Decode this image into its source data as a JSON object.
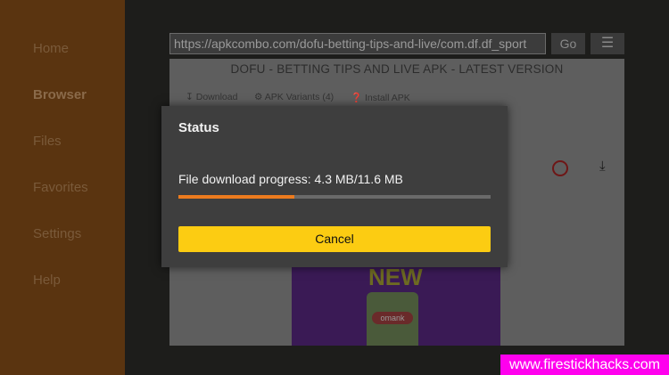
{
  "sidebar": {
    "items": [
      {
        "label": "Home"
      },
      {
        "label": "Browser"
      },
      {
        "label": "Files"
      },
      {
        "label": "Favorites"
      },
      {
        "label": "Settings"
      },
      {
        "label": "Help"
      }
    ],
    "active_index": 1
  },
  "browser": {
    "url": "https://apkcombo.com/dofu-betting-tips-and-live/com.df.df_sport",
    "go_label": "Go",
    "menu_icon": "hamburger-menu-icon"
  },
  "webpage": {
    "title": "DOFU - BETTING TIPS AND LIVE APK - LATEST VERSION",
    "links": [
      {
        "label": "Download",
        "icon": "download-icon"
      },
      {
        "label": "APK Variants (4)",
        "icon": "gear-icon"
      },
      {
        "label": "Install APK",
        "icon": "help-icon"
      }
    ],
    "promo_text": "NEW",
    "promo_badge": "omank"
  },
  "dialog": {
    "title": "Status",
    "progress_text": "File download progress: 4.3 MB/11.6 MB",
    "downloaded_mb": 4.3,
    "total_mb": 11.6,
    "cancel_label": "Cancel"
  },
  "colors": {
    "accent": "#fccc12",
    "progress": "#ec7b1e",
    "sidebar": "#5a3410"
  },
  "watermark": "www.firestickhacks.com"
}
